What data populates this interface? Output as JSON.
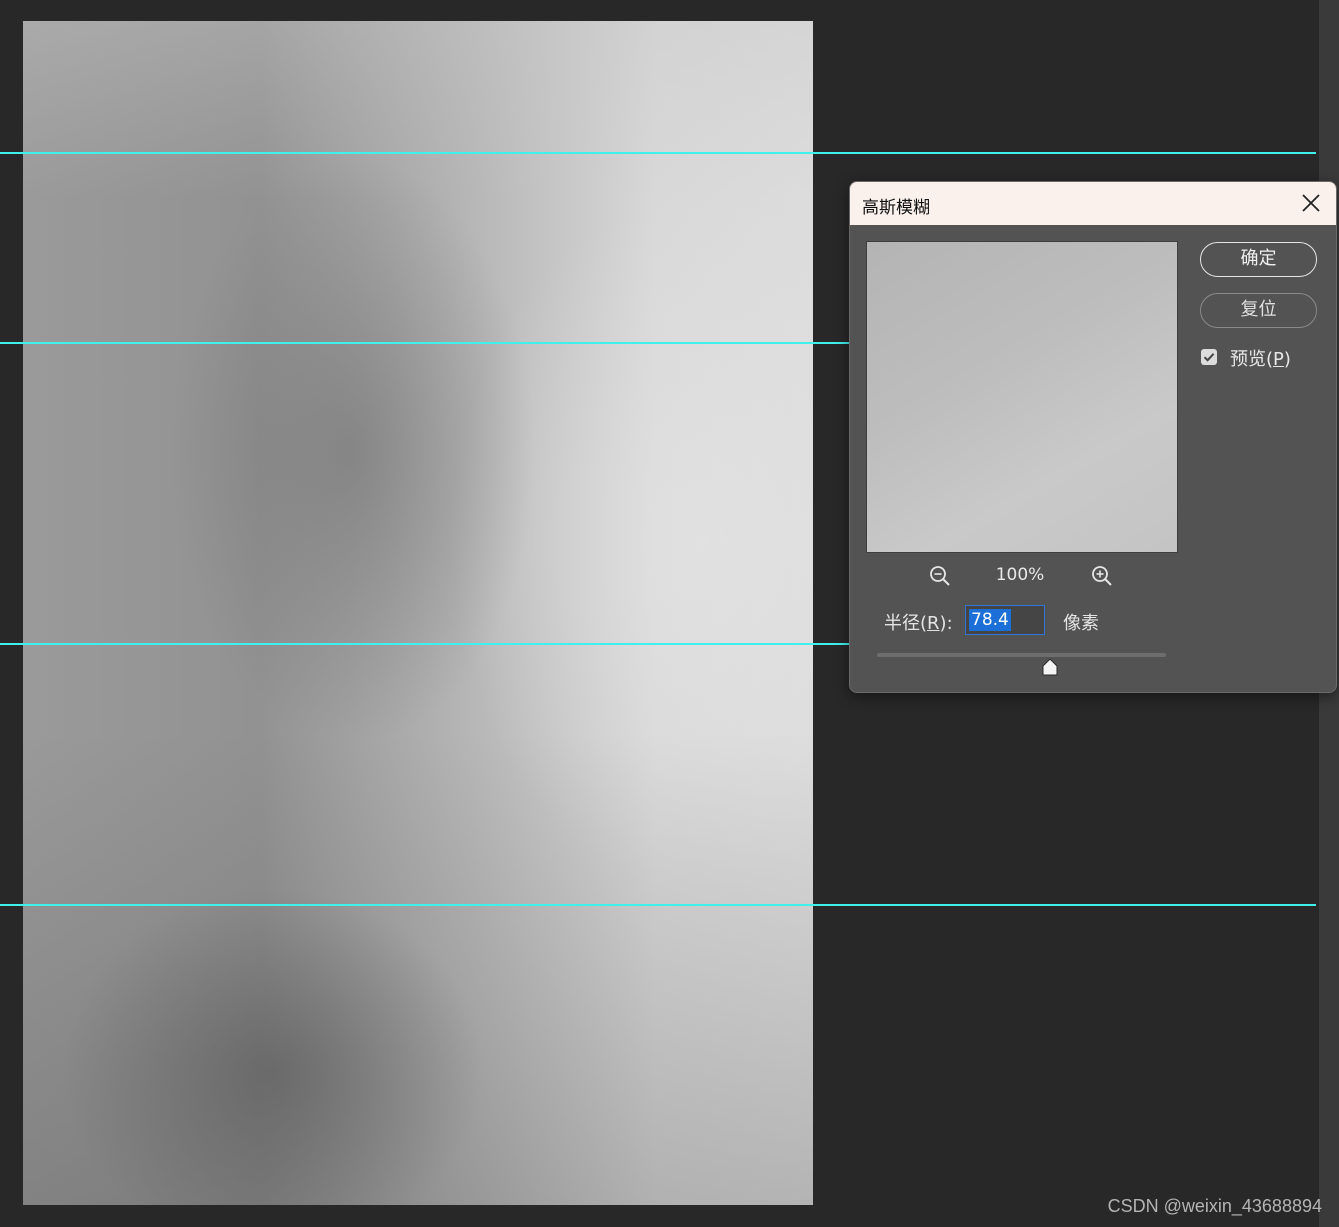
{
  "dialog": {
    "title": "高斯模糊",
    "ok_label": "确定",
    "reset_label": "复位",
    "preview_checkbox": {
      "label": "预览",
      "mnemonic": "P",
      "checked": true
    },
    "zoom": {
      "level": "100%",
      "zoom_out_icon": "zoom-out-icon",
      "zoom_in_icon": "zoom-in-icon"
    },
    "radius": {
      "label": "半径",
      "mnemonic": "R",
      "value": "78.4",
      "unit": "像素",
      "slider_fraction": 0.6
    },
    "close_icon": "close-icon"
  },
  "canvas": {
    "guide_color": "#3ff0ee"
  },
  "watermark": "CSDN @weixin_43688894"
}
